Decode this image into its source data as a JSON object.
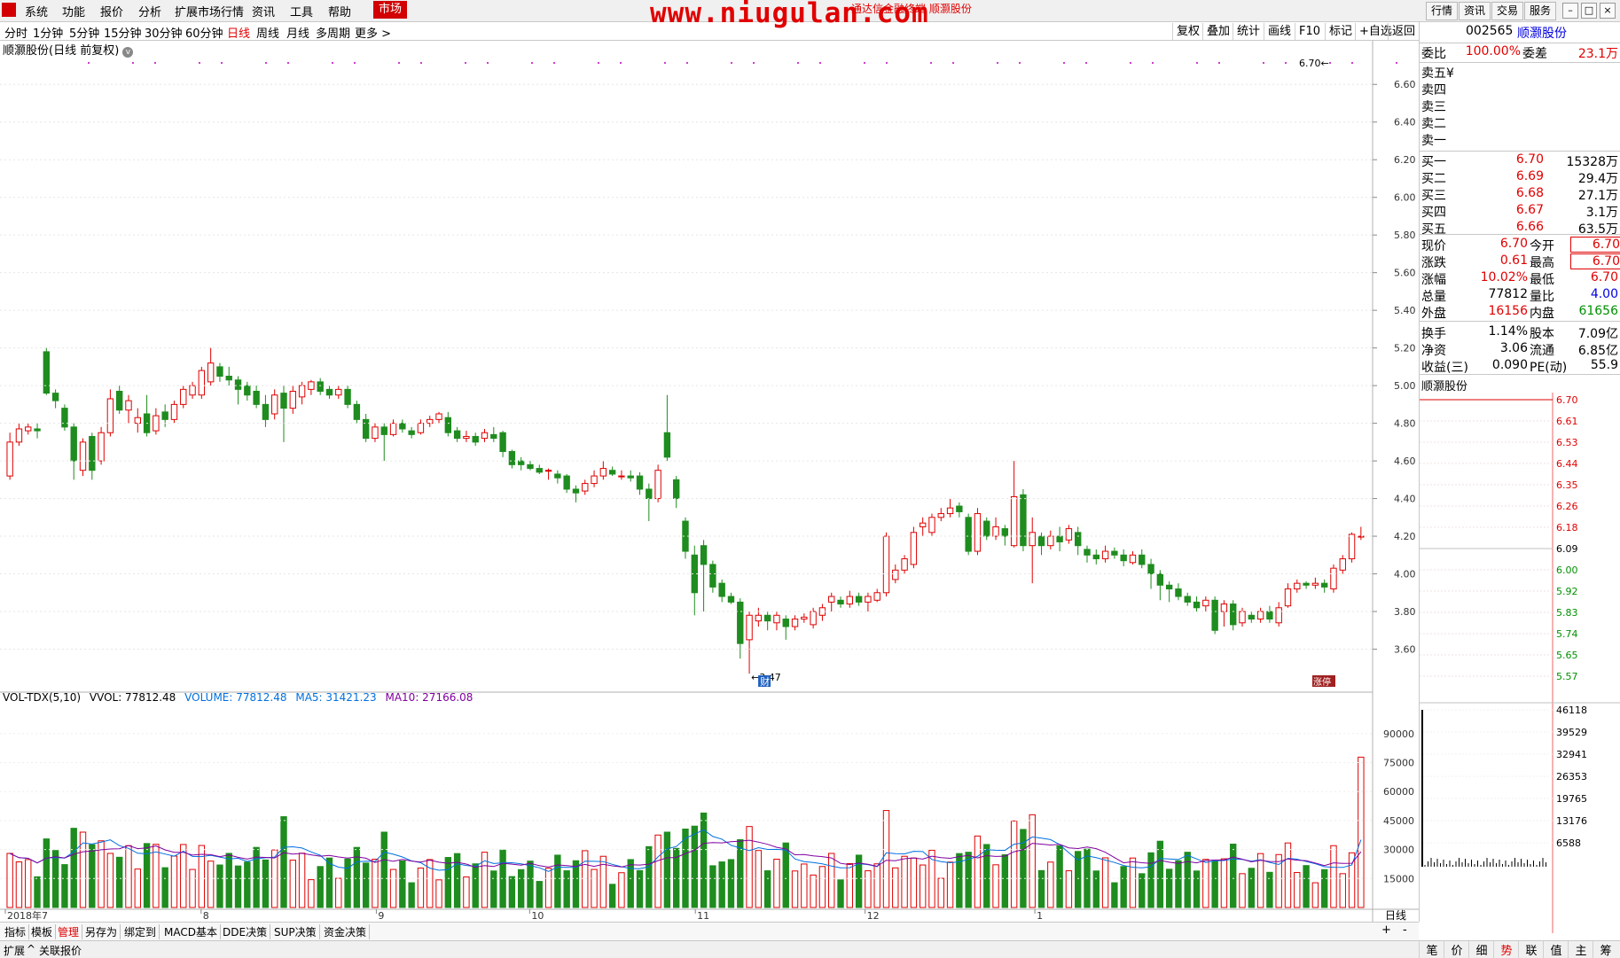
{
  "menubar": {
    "items": [
      "系统",
      "功能",
      "报价",
      "分析",
      "扩展市场行情",
      "资讯",
      "工具",
      "帮助"
    ],
    "active": "市场",
    "watermark": "www.niugulan.com",
    "watermark_small": "通达信金融终端 顺灏股份",
    "right_buttons": [
      "行情",
      "资讯",
      "交易",
      "服务"
    ]
  },
  "periods": {
    "items": [
      "分时",
      "1分钟",
      "5分钟",
      "15分钟",
      "30分钟",
      "60分钟",
      "日线",
      "周线",
      "月线",
      "多周期",
      "更多 >"
    ],
    "active": "日线"
  },
  "toolbar": {
    "items": [
      "复权",
      "叠加",
      "统计",
      "画线",
      "F10",
      "标记",
      "+自选",
      "返回"
    ]
  },
  "chart_title": "顺灏股份(日线 前复权)",
  "price_axis": {
    "ticks": [
      "6.60",
      "6.40",
      "6.20",
      "6.00",
      "5.80",
      "5.60",
      "5.40",
      "5.20",
      "5.00",
      "4.80",
      "4.60",
      "4.40",
      "4.20",
      "4.00",
      "3.80",
      "3.60"
    ]
  },
  "annotations": {
    "low_label": "3.47",
    "high_label": "6.70",
    "cai_tag": "财",
    "zhangting_tag": "涨停"
  },
  "volume_header": {
    "name": "VOL-TDX(5,10)",
    "vvol": "VVOL: 77812.48",
    "volume": "VOLUME: 77812.48",
    "ma5": "MA5: 31421.23",
    "ma10": "MA10: 27166.08"
  },
  "volume_axis": {
    "ticks": [
      "90000",
      "75000",
      "60000",
      "45000",
      "30000",
      "15000"
    ]
  },
  "date_axis": {
    "labels": [
      "2018年7",
      "8",
      "9",
      "10",
      "11",
      "12",
      "1"
    ],
    "corner": "日线"
  },
  "bottom_tabs": [
    "指标",
    "模板",
    "管理",
    "另存为",
    "绑定到",
    "MACD基本",
    "DDE决策",
    "SUP决策",
    "资金决策"
  ],
  "bottom_tabs_active": "管理",
  "status": {
    "left": "扩展",
    "item": "关联报价"
  },
  "quote": {
    "code": "002565",
    "name": "顺灏股份",
    "weibi_label": "委比",
    "weibi": "100.00%",
    "weicha_label": "委差",
    "weicha": "23.1万",
    "sell": [
      {
        "label": "卖五",
        "mark": "¥"
      },
      {
        "label": "卖四",
        "mark": ""
      },
      {
        "label": "卖三",
        "mark": ""
      },
      {
        "label": "卖二",
        "mark": ""
      },
      {
        "label": "卖一",
        "mark": ""
      }
    ],
    "buy": [
      {
        "label": "买一",
        "price": "6.70",
        "vol": "15328万"
      },
      {
        "label": "买二",
        "price": "6.69",
        "vol": "29.4万"
      },
      {
        "label": "买三",
        "price": "6.68",
        "vol": "27.1万"
      },
      {
        "label": "买四",
        "price": "6.67",
        "vol": "3.1万"
      },
      {
        "label": "买五",
        "price": "6.66",
        "vol": "63.5万"
      }
    ],
    "stats": [
      {
        "l1": "现价",
        "v1": "6.70",
        "l2": "今开",
        "v2": "6.70"
      },
      {
        "l1": "涨跌",
        "v1": "0.61",
        "l2": "最高",
        "v2": "6.70"
      },
      {
        "l1": "涨幅",
        "v1": "10.02%",
        "l2": "最低",
        "v2": "6.70"
      },
      {
        "l1": "总量",
        "v1": "77812",
        "l2": "量比",
        "v2": "4.00"
      },
      {
        "l1": "外盘",
        "v1": "16156",
        "l2": "内盘",
        "v2": "61656"
      },
      {
        "l1": "换手",
        "v1": "1.14%",
        "l2": "股本",
        "v2": "7.09亿"
      },
      {
        "l1": "净资",
        "v1": "3.06",
        "l2": "流通",
        "v2": "6.85亿"
      },
      {
        "l1": "收益(三)",
        "v1": "0.090",
        "l2": "PE(动)",
        "v2": "55.9"
      }
    ]
  },
  "mini_chart": {
    "title": "顺灏股份",
    "price_ticks": [
      "6.70",
      "6.61",
      "6.53",
      "6.44",
      "6.35",
      "6.26",
      "6.18",
      "6.09",
      "6.00",
      "5.92",
      "5.83",
      "5.74",
      "5.65",
      "5.57"
    ],
    "vol_ticks": [
      "46118",
      "39529",
      "32941",
      "26353",
      "19765",
      "13176",
      "6588"
    ]
  },
  "mini_tabs": [
    "笔",
    "价",
    "细",
    "势",
    "联",
    "值",
    "主",
    "筹"
  ],
  "mini_tabs_active": "势",
  "colors": {
    "up": "#e00000",
    "down": "#1e8c1e",
    "ma5": "#0070e0",
    "ma10": "#8000a0",
    "accent": "#d20000"
  },
  "chart_data": {
    "type": "candlestick",
    "title": "顺灏股份(日线 前复权)",
    "xlabel": "",
    "ylabel": "",
    "ylim": [
      3.4,
      6.7
    ],
    "x_groups": [
      "2018年7",
      "8",
      "9",
      "10",
      "11",
      "12",
      "1"
    ],
    "candles": [
      [
        4.52,
        4.7,
        4.75,
        4.5
      ],
      [
        4.7,
        4.77,
        4.8,
        4.68
      ],
      [
        4.76,
        4.78,
        4.8,
        4.74
      ],
      [
        4.77,
        4.76,
        4.8,
        4.72
      ],
      [
        5.18,
        4.96,
        5.2,
        4.95
      ],
      [
        4.96,
        4.92,
        4.98,
        4.88
      ],
      [
        4.88,
        4.78,
        4.9,
        4.76
      ],
      [
        4.78,
        4.6,
        4.8,
        4.5
      ],
      [
        4.55,
        4.7,
        4.72,
        4.52
      ],
      [
        4.73,
        4.55,
        4.75,
        4.5
      ],
      [
        4.6,
        4.75,
        4.78,
        4.58
      ],
      [
        4.75,
        4.93,
        4.98,
        4.73
      ],
      [
        4.97,
        4.87,
        5.0,
        4.85
      ],
      [
        4.87,
        4.92,
        4.95,
        4.8
      ],
      [
        4.8,
        4.83,
        4.88,
        4.75
      ],
      [
        4.85,
        4.75,
        4.95,
        4.73
      ],
      [
        4.76,
        4.84,
        4.88,
        4.74
      ],
      [
        4.86,
        4.82,
        4.9,
        4.78
      ],
      [
        4.82,
        4.9,
        4.92,
        4.8
      ],
      [
        4.9,
        4.98,
        5.0,
        4.88
      ],
      [
        4.95,
        5.0,
        5.02,
        4.93
      ],
      [
        4.95,
        5.08,
        5.1,
        4.93
      ],
      [
        5.02,
        5.12,
        5.2,
        5.0
      ],
      [
        5.1,
        5.05,
        5.12,
        5.02
      ],
      [
        5.05,
        5.03,
        5.1,
        5.0
      ],
      [
        5.03,
        4.98,
        5.05,
        4.9
      ],
      [
        5.0,
        4.95,
        5.02,
        4.92
      ],
      [
        4.97,
        4.9,
        5.0,
        4.88
      ],
      [
        4.9,
        4.82,
        4.95,
        4.78
      ],
      [
        4.85,
        4.95,
        4.98,
        4.82
      ],
      [
        4.96,
        4.88,
        5.0,
        4.7
      ],
      [
        4.88,
        4.97,
        5.0,
        4.85
      ],
      [
        4.94,
        5.0,
        5.02,
        4.9
      ],
      [
        4.98,
        5.02,
        5.03,
        4.95
      ],
      [
        5.02,
        4.97,
        5.04,
        4.95
      ],
      [
        4.98,
        4.95,
        5.0,
        4.93
      ],
      [
        4.95,
        4.98,
        5.0,
        4.93
      ],
      [
        4.98,
        4.9,
        5.0,
        4.88
      ],
      [
        4.9,
        4.82,
        4.92,
        4.8
      ],
      [
        4.82,
        4.72,
        4.85,
        4.7
      ],
      [
        4.72,
        4.78,
        4.8,
        4.7
      ],
      [
        4.78,
        4.74,
        4.8,
        4.6
      ],
      [
        4.74,
        4.8,
        4.82,
        4.73
      ],
      [
        4.8,
        4.77,
        4.82,
        4.75
      ],
      [
        4.76,
        4.74,
        4.78,
        4.72
      ],
      [
        4.75,
        4.8,
        4.82,
        4.74
      ],
      [
        4.8,
        4.82,
        4.84,
        4.78
      ],
      [
        4.82,
        4.85,
        4.86,
        4.8
      ],
      [
        4.83,
        4.75,
        4.86,
        4.73
      ],
      [
        4.76,
        4.72,
        4.78,
        4.7
      ],
      [
        4.72,
        4.73,
        4.76,
        4.7
      ],
      [
        4.73,
        4.7,
        4.75,
        4.68
      ],
      [
        4.72,
        4.75,
        4.77,
        4.7
      ],
      [
        4.74,
        4.72,
        4.78,
        4.7
      ],
      [
        4.75,
        4.65,
        4.76,
        4.62
      ],
      [
        4.65,
        4.58,
        4.66,
        4.56
      ],
      [
        4.6,
        4.58,
        4.62,
        4.55
      ],
      [
        4.58,
        4.56,
        4.6,
        4.55
      ],
      [
        4.56,
        4.54,
        4.58,
        4.53
      ],
      [
        4.55,
        4.55,
        4.56,
        4.5
      ],
      [
        4.53,
        4.51,
        4.55,
        4.48
      ],
      [
        4.52,
        4.45,
        4.53,
        4.43
      ],
      [
        4.45,
        4.43,
        4.47,
        4.38
      ],
      [
        4.44,
        4.48,
        4.5,
        4.42
      ],
      [
        4.48,
        4.52,
        4.55,
        4.46
      ],
      [
        4.52,
        4.56,
        4.6,
        4.5
      ],
      [
        4.55,
        4.53,
        4.57,
        4.52
      ],
      [
        4.52,
        4.52,
        4.55,
        4.5
      ],
      [
        4.52,
        4.51,
        4.55,
        4.49
      ],
      [
        4.52,
        4.45,
        4.54,
        4.42
      ],
      [
        4.45,
        4.4,
        4.48,
        4.28
      ],
      [
        4.4,
        4.55,
        4.58,
        4.38
      ],
      [
        4.75,
        4.62,
        4.95,
        4.6
      ],
      [
        4.5,
        4.4,
        4.52,
        4.35
      ],
      [
        4.28,
        4.12,
        4.3,
        4.08
      ],
      [
        4.1,
        3.9,
        4.15,
        3.78
      ],
      [
        4.15,
        4.05,
        4.18,
        3.8
      ],
      [
        4.05,
        3.93,
        4.07,
        3.9
      ],
      [
        3.95,
        3.88,
        3.97,
        3.85
      ],
      [
        3.88,
        3.85,
        3.9,
        3.84
      ],
      [
        3.85,
        3.63,
        3.87,
        3.55
      ],
      [
        3.65,
        3.78,
        3.8,
        3.47
      ],
      [
        3.75,
        3.78,
        3.82,
        3.72
      ],
      [
        3.78,
        3.75,
        3.8,
        3.7
      ],
      [
        3.74,
        3.78,
        3.8,
        3.7
      ],
      [
        3.76,
        3.72,
        3.78,
        3.65
      ],
      [
        3.72,
        3.76,
        3.78,
        3.7
      ],
      [
        3.76,
        3.77,
        3.79,
        3.74
      ],
      [
        3.73,
        3.8,
        3.82,
        3.71
      ],
      [
        3.78,
        3.82,
        3.84,
        3.75
      ],
      [
        3.85,
        3.88,
        3.9,
        3.8
      ],
      [
        3.86,
        3.84,
        3.88,
        3.82
      ],
      [
        3.84,
        3.88,
        3.91,
        3.82
      ],
      [
        3.88,
        3.85,
        3.9,
        3.83
      ],
      [
        3.85,
        3.88,
        3.9,
        3.8
      ],
      [
        3.86,
        3.9,
        3.92,
        3.85
      ],
      [
        3.9,
        4.2,
        4.22,
        3.88
      ],
      [
        3.97,
        4.02,
        4.05,
        3.95
      ],
      [
        4.02,
        4.08,
        4.1,
        4.0
      ],
      [
        4.05,
        4.22,
        4.25,
        4.03
      ],
      [
        4.25,
        4.27,
        4.3,
        4.2
      ],
      [
        4.22,
        4.3,
        4.32,
        4.2
      ],
      [
        4.3,
        4.32,
        4.35,
        4.28
      ],
      [
        4.32,
        4.35,
        4.4,
        4.3
      ],
      [
        4.36,
        4.33,
        4.38,
        4.3
      ],
      [
        4.3,
        4.12,
        4.32,
        4.1
      ],
      [
        4.12,
        4.32,
        4.35,
        4.1
      ],
      [
        4.28,
        4.2,
        4.3,
        4.18
      ],
      [
        4.2,
        4.25,
        4.3,
        4.18
      ],
      [
        4.24,
        4.2,
        4.26,
        4.15
      ],
      [
        4.15,
        4.41,
        4.6,
        4.14
      ],
      [
        4.42,
        4.15,
        4.45,
        4.12
      ],
      [
        4.15,
        4.22,
        4.3,
        3.95
      ],
      [
        4.2,
        4.15,
        4.22,
        4.1
      ],
      [
        4.15,
        4.2,
        4.23,
        4.13
      ],
      [
        4.2,
        4.17,
        4.25,
        4.12
      ],
      [
        4.18,
        4.24,
        4.26,
        4.16
      ],
      [
        4.22,
        4.15,
        4.25,
        4.1
      ],
      [
        4.13,
        4.1,
        4.15,
        4.06
      ],
      [
        4.1,
        4.08,
        4.13,
        4.05
      ],
      [
        4.08,
        4.12,
        4.15,
        4.06
      ],
      [
        4.12,
        4.1,
        4.14,
        4.08
      ],
      [
        4.1,
        4.07,
        4.13,
        4.04
      ],
      [
        4.06,
        4.1,
        4.12,
        4.05
      ],
      [
        4.1,
        4.05,
        4.13,
        4.03
      ],
      [
        4.05,
        4.0,
        4.08,
        3.92
      ],
      [
        4.0,
        3.94,
        4.02,
        3.86
      ],
      [
        3.94,
        3.92,
        3.96,
        3.85
      ],
      [
        3.92,
        3.88,
        3.95,
        3.86
      ],
      [
        3.88,
        3.85,
        3.9,
        3.83
      ],
      [
        3.85,
        3.82,
        3.88,
        3.8
      ],
      [
        3.83,
        3.86,
        3.88,
        3.8
      ],
      [
        3.86,
        3.7,
        3.88,
        3.68
      ],
      [
        3.8,
        3.84,
        3.86,
        3.72
      ],
      [
        3.84,
        3.73,
        3.86,
        3.7
      ],
      [
        3.74,
        3.8,
        3.82,
        3.72
      ],
      [
        3.78,
        3.76,
        3.8,
        3.74
      ],
      [
        3.76,
        3.8,
        3.82,
        3.74
      ],
      [
        3.8,
        3.76,
        3.83,
        3.74
      ],
      [
        3.74,
        3.82,
        3.85,
        3.72
      ],
      [
        3.83,
        3.92,
        3.95,
        3.82
      ],
      [
        3.92,
        3.95,
        3.97,
        3.9
      ],
      [
        3.95,
        3.94,
        3.96,
        3.92
      ],
      [
        3.94,
        3.95,
        3.98,
        3.92
      ],
      [
        3.95,
        3.93,
        3.97,
        3.9
      ],
      [
        3.92,
        4.03,
        4.05,
        3.9
      ],
      [
        4.02,
        4.08,
        4.1,
        4.0
      ],
      [
        4.08,
        4.21,
        4.22,
        4.06
      ],
      [
        4.2,
        4.2,
        4.25,
        4.18
      ]
    ],
    "volume": [],
    "last_volume": 77812.48,
    "ma5_last": 31421.23,
    "ma10_last": 27166.08
  }
}
